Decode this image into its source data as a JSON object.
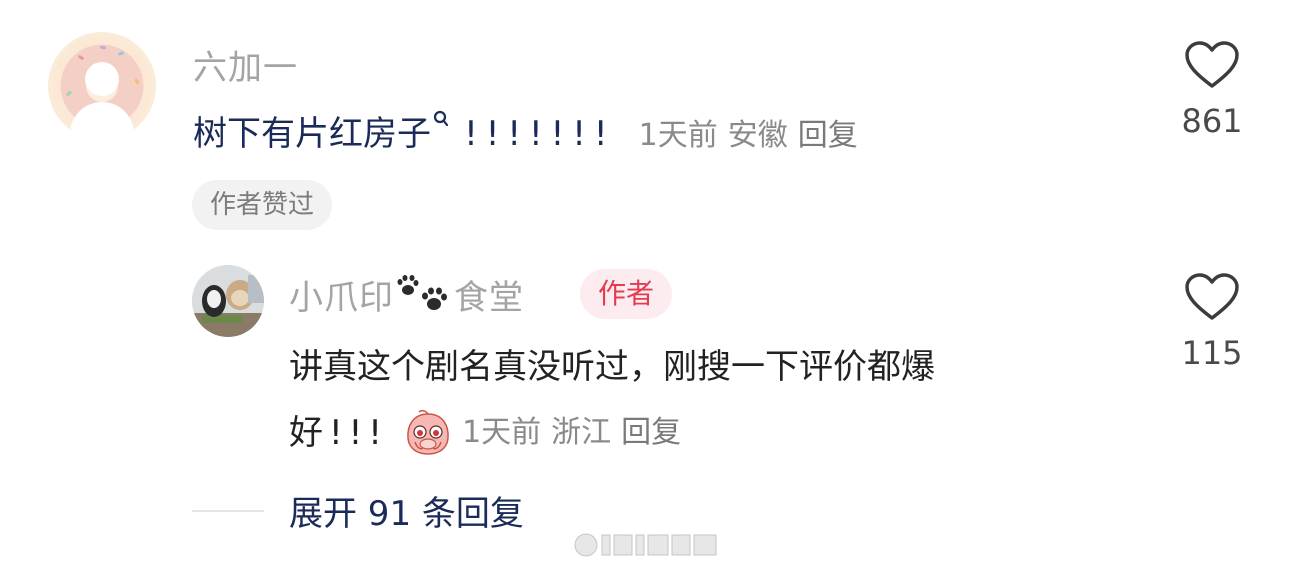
{
  "comment": {
    "username": "六加一",
    "text": "树下有片红房子",
    "exclaim": "!!!!!!!",
    "time": "1天前",
    "location": "安徽",
    "reply_label": "回复",
    "like_count": "861",
    "author_liked_badge": "作者赞过"
  },
  "reply": {
    "username_pre": "小爪印",
    "username_post": "食堂",
    "author_badge": "作者",
    "text_line1": "讲真这个剧名真没听过，刚搜一下评价都爆",
    "text_line2": "好!!!",
    "time": "1天前",
    "location": "浙江",
    "reply_label": "回复",
    "like_count": "115"
  },
  "expand": {
    "label": "展开 91 条回复"
  },
  "colors": {
    "link_navy": "#1b2b59",
    "author_red": "#e43b4f",
    "author_badge_bg": "#fdecef",
    "muted_gray": "#8a8a8a"
  },
  "icons": {
    "like": "heart-outline-icon",
    "paw": "paw-print-icon",
    "search_mini": "search-icon",
    "emoji": "crying-peach-emoji-icon"
  }
}
